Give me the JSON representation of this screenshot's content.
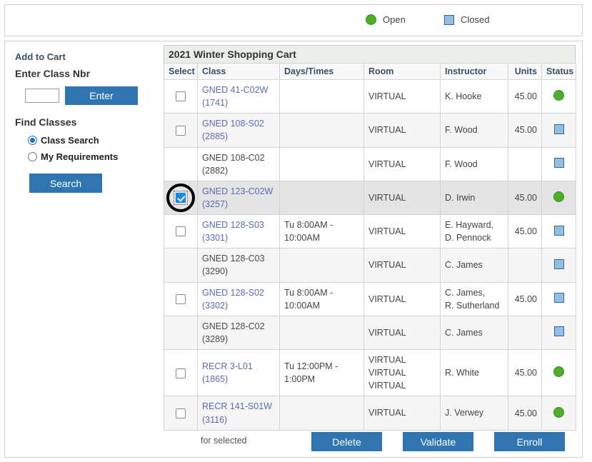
{
  "legend": {
    "open_label": "Open",
    "closed_label": "Closed",
    "open_icon": "green-circle-icon",
    "closed_icon": "blue-square-icon",
    "open_color": "#4cae2b",
    "closed_color": "#93bde2"
  },
  "sidebar": {
    "add_to_cart_heading": "Add to Cart",
    "enter_class_nbr_label": "Enter Class Nbr",
    "class_nbr_value": "",
    "class_nbr_placeholder": "",
    "enter_button": "Enter",
    "find_classes_heading": "Find Classes",
    "options": [
      {
        "label": "Class Search",
        "selected": true
      },
      {
        "label": "My Requirements",
        "selected": false
      }
    ],
    "search_button": "Search"
  },
  "cart": {
    "title": "2021 Winter Shopping Cart",
    "columns": [
      "Select",
      "Class",
      "Days/Times",
      "Room",
      "Instructor",
      "Units",
      "Status"
    ],
    "rows": [
      {
        "checkbox": true,
        "checked": false,
        "highlighted": false,
        "class_name": "GNED 41-C02W",
        "class_nbr": "(1741)",
        "is_link": true,
        "days_times": "",
        "room": "VIRTUAL",
        "instructor": "K. Hooke",
        "units": "45.00",
        "status": "open"
      },
      {
        "checkbox": true,
        "checked": false,
        "highlighted": false,
        "class_name": "GNED 108-S02",
        "class_nbr": "(2885)",
        "is_link": true,
        "days_times": "",
        "room": "VIRTUAL",
        "instructor": "F. Wood",
        "units": "45.00",
        "status": "closed"
      },
      {
        "checkbox": false,
        "checked": false,
        "highlighted": false,
        "class_name": "GNED 108-C02",
        "class_nbr": "(2882)",
        "is_link": false,
        "days_times": "",
        "room": "VIRTUAL",
        "instructor": "F. Wood",
        "units": "",
        "status": "closed"
      },
      {
        "checkbox": true,
        "checked": true,
        "highlighted": true,
        "annotated": true,
        "class_name": "GNED 123-C02W",
        "class_nbr": "(3257)",
        "is_link": true,
        "days_times": "",
        "room": "VIRTUAL",
        "instructor": "D. Irwin",
        "units": "45.00",
        "status": "open"
      },
      {
        "checkbox": true,
        "checked": false,
        "highlighted": false,
        "class_name": "GNED 128-S03",
        "class_nbr": "(3301)",
        "is_link": true,
        "days_times": "Tu 8:00AM - 10:00AM",
        "room": "VIRTUAL",
        "instructor": "E. Hayward, D. Pennock",
        "units": "45.00",
        "status": "closed"
      },
      {
        "checkbox": false,
        "checked": false,
        "highlighted": false,
        "class_name": "GNED 128-C03",
        "class_nbr": "(3290)",
        "is_link": false,
        "days_times": "",
        "room": "VIRTUAL",
        "instructor": "C. James",
        "units": "",
        "status": "closed"
      },
      {
        "checkbox": true,
        "checked": false,
        "highlighted": false,
        "class_name": "GNED 128-S02",
        "class_nbr": "(3302)",
        "is_link": true,
        "days_times": "Tu 8:00AM - 10:00AM",
        "room": "VIRTUAL",
        "instructor": "C. James, R. Sutherland",
        "units": "45.00",
        "status": "closed"
      },
      {
        "checkbox": false,
        "checked": false,
        "highlighted": false,
        "class_name": "GNED 128-C02",
        "class_nbr": "(3289)",
        "is_link": false,
        "days_times": "",
        "room": "VIRTUAL",
        "instructor": "C. James",
        "units": "",
        "status": "closed"
      },
      {
        "checkbox": true,
        "checked": false,
        "highlighted": false,
        "class_name": "RECR 3-L01",
        "class_nbr": "(1865)",
        "is_link": true,
        "days_times": "Tu 12:00PM - 1:00PM",
        "room": "VIRTUAL VIRTUAL VIRTUAL",
        "instructor": "R. White",
        "units": "45.00",
        "status": "open"
      },
      {
        "checkbox": true,
        "checked": false,
        "highlighted": false,
        "class_name": "RECR 141-S01W",
        "class_nbr": "(3116)",
        "is_link": true,
        "days_times": "",
        "room": "VIRTUAL",
        "instructor": "J. Verwey",
        "units": "45.00",
        "status": "open"
      }
    ]
  },
  "footer": {
    "for_selected_label": "for selected",
    "delete_button": "Delete",
    "validate_button": "Validate",
    "enroll_button": "Enroll"
  },
  "colors": {
    "button_blue": "#2e75b1",
    "link_purple": "#5b6bb5",
    "heading_blue": "#3b5068",
    "checked_box": "#1a87e8"
  }
}
